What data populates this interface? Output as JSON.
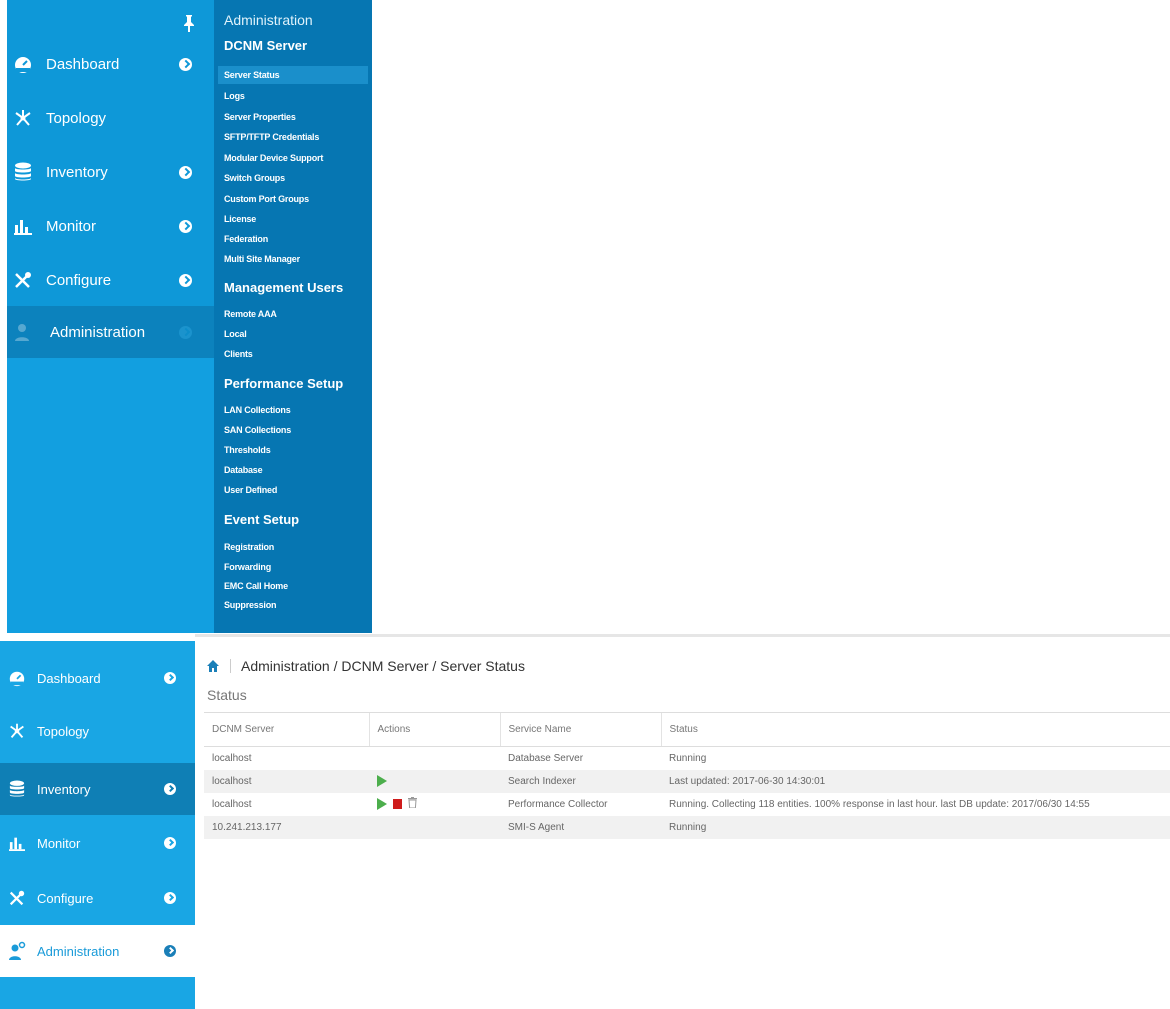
{
  "top_panel": {
    "nav": [
      {
        "label": "Dashboard",
        "icon": "dashboard-icon"
      },
      {
        "label": "Topology",
        "icon": "topology-icon"
      },
      {
        "label": "Inventory",
        "icon": "database-icon"
      },
      {
        "label": "Monitor",
        "icon": "bar-chart-icon"
      },
      {
        "label": "Configure",
        "icon": "tools-icon"
      },
      {
        "label": "Administration",
        "icon": "admin-icon"
      }
    ],
    "submenu": {
      "header": "Administration",
      "sections": [
        {
          "title": "DCNM Server",
          "items": [
            "Server Status",
            "Logs",
            "Server Properties",
            "SFTP/TFTP Credentials",
            "Modular Device Support",
            "Switch Groups",
            "Custom Port Groups",
            "License",
            "Federation",
            "Multi Site Manager"
          ]
        },
        {
          "title": "Management Users",
          "items": [
            "Remote AAA",
            "Local",
            "Clients"
          ]
        },
        {
          "title": "Performance Setup",
          "items": [
            "LAN Collections",
            "SAN Collections",
            "Thresholds",
            "Database",
            "User Defined"
          ]
        },
        {
          "title": "Event Setup",
          "items": [
            "Registration",
            "Forwarding",
            "EMC Call Home",
            "Suppression"
          ]
        }
      ]
    }
  },
  "bottom_panel": {
    "nav": [
      {
        "label": "Dashboard"
      },
      {
        "label": "Topology"
      },
      {
        "label": "Inventory"
      },
      {
        "label": "Monitor"
      },
      {
        "label": "Configure"
      },
      {
        "label": "Administration"
      }
    ],
    "breadcrumb": "Administration / DCNM Server / Server Status",
    "status_title": "Status",
    "table": {
      "columns": [
        "DCNM Server",
        "Actions",
        "Service Name",
        "Status"
      ],
      "rows": [
        {
          "server": "localhost",
          "service": "Database Server",
          "status": "Running"
        },
        {
          "server": "localhost",
          "service": "Search Indexer",
          "status": "Last updated: 2017-06-30 14:30:01"
        },
        {
          "server": "localhost",
          "service": "Performance Collector",
          "status": "Running. Collecting 118 entities. 100% response in last hour. last DB update: 2017/06/30 14:55"
        },
        {
          "server": "10.241.213.177",
          "service": "SMI-S Agent",
          "status": "Running"
        }
      ]
    }
  },
  "colors": {
    "sidebar": "#0e98d8",
    "submenu": "#0676b2",
    "bottom_sidebar": "#19a6e4",
    "play": "#4cae4c",
    "stop": "#cf1c1c"
  }
}
